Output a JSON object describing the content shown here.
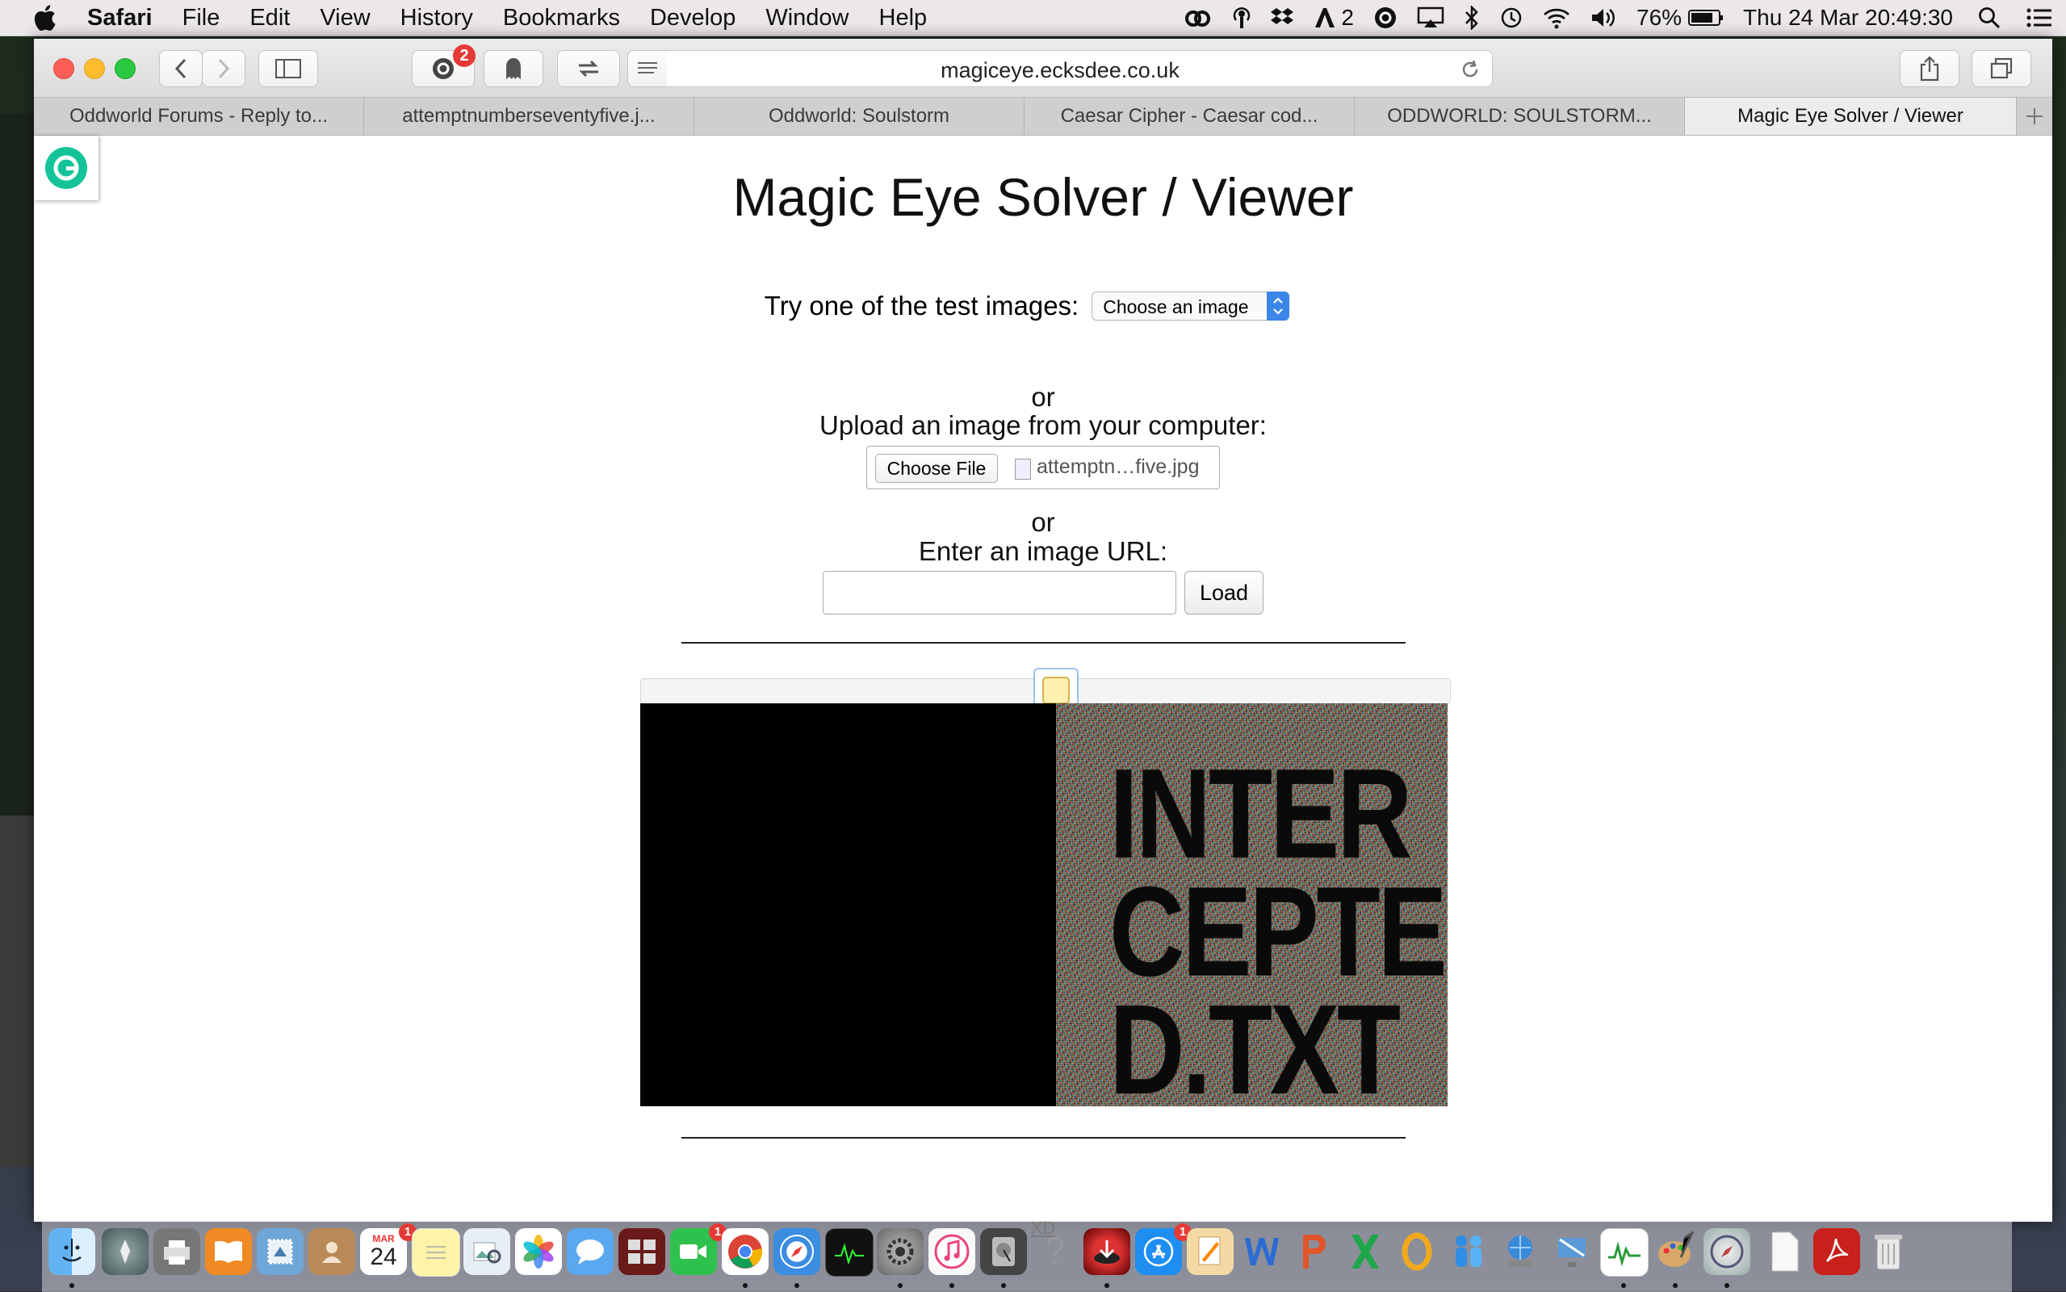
{
  "menubar": {
    "app": "Safari",
    "items": [
      "File",
      "Edit",
      "View",
      "History",
      "Bookmarks",
      "Develop",
      "Window",
      "Help"
    ],
    "status": {
      "adobe_count": "2",
      "battery": "76%",
      "datetime": "Thu 24 Mar  20:49:30"
    }
  },
  "browser": {
    "url": "magiceye.ecksdee.co.uk",
    "extension_badge": "2",
    "tabs": [
      "Oddworld Forums - Reply to...",
      "attemptnumberseventyfive.j...",
      "Oddworld: Soulstorm",
      "Caesar Cipher - Caesar cod...",
      "ODDWORLD: SOULSTORM...",
      "Magic Eye Solver / Viewer"
    ],
    "active_tab": 5
  },
  "page": {
    "title": "Magic Eye Solver / Viewer",
    "test_label": "Try one of the test images:",
    "test_select": "Choose an image",
    "or1": "or",
    "upload_label": "Upload an image from your computer:",
    "choose_file": "Choose File",
    "file_name": "attemptn…five.jpg",
    "or2": "or",
    "url_label": "Enter an image URL:",
    "url_value": "",
    "load": "Load",
    "viewer_text": [
      "INTER",
      "CEPTE",
      "D.TXT"
    ],
    "footer_link": "XD"
  },
  "dock": {
    "calendar_month": "MAR",
    "calendar_day": "24",
    "calendar_badge": "1",
    "facetime_badge": "1",
    "appstore_badge": "1"
  }
}
